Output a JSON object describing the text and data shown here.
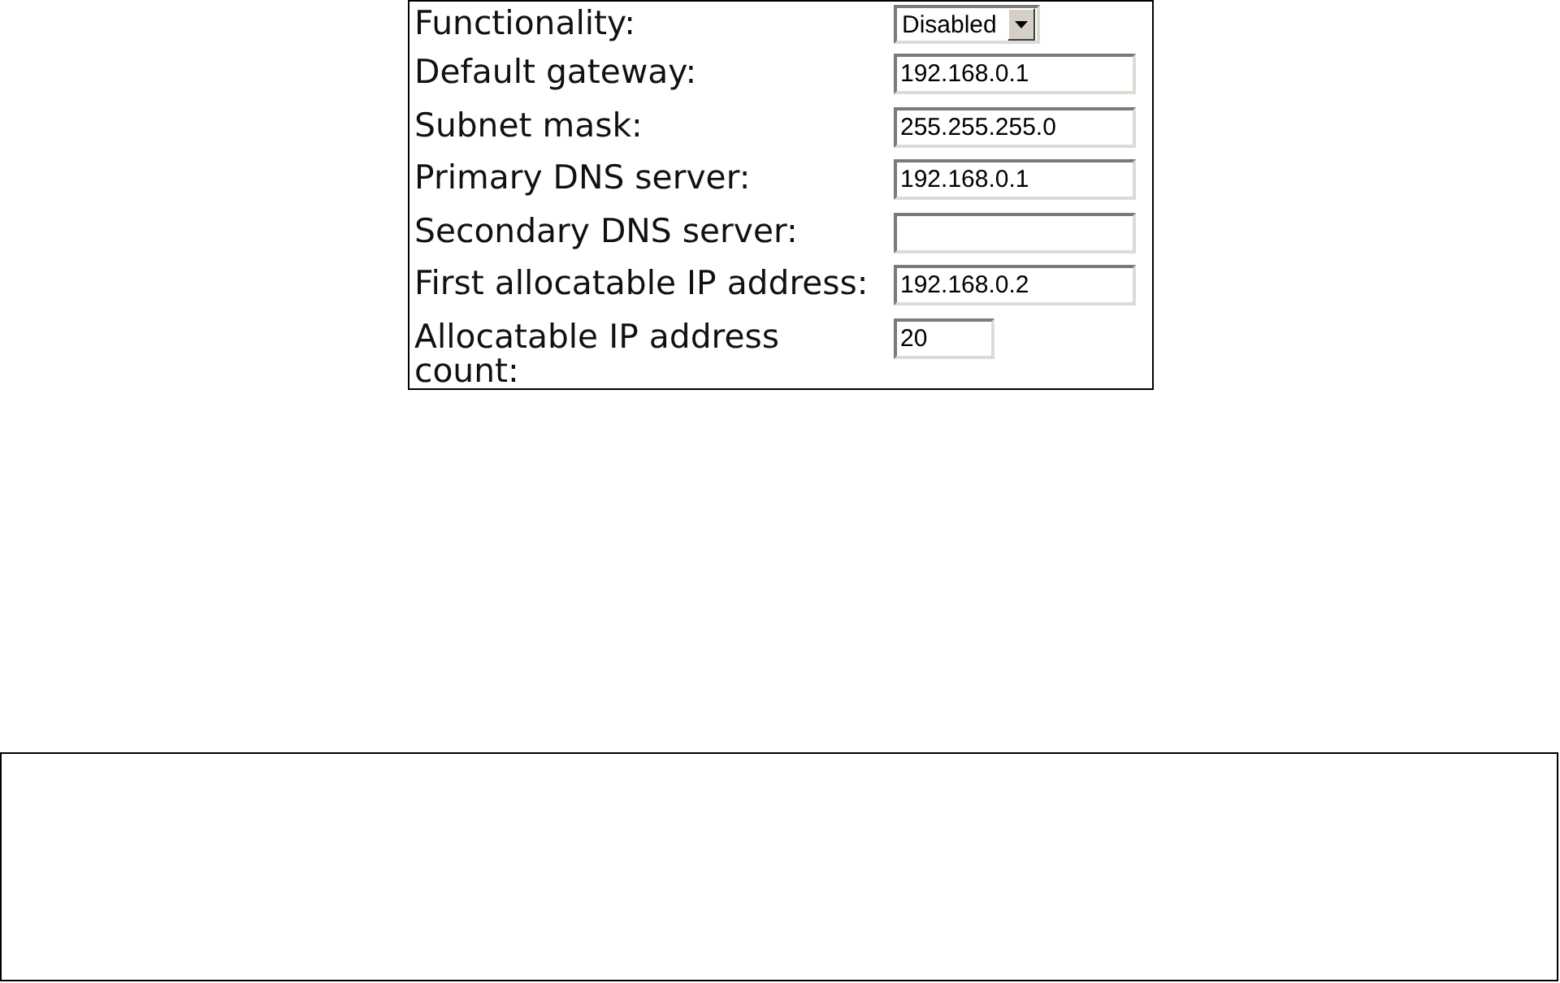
{
  "form": {
    "rows": [
      {
        "label": "Functionality:",
        "kind": "select",
        "value": "Disabled"
      },
      {
        "label": "Default gateway:",
        "kind": "text",
        "value": "192.168.0.1"
      },
      {
        "label": "Subnet mask:",
        "kind": "text",
        "value": "255.255.255.0"
      },
      {
        "label": "Primary DNS server:",
        "kind": "text",
        "value": "192.168.0.1"
      },
      {
        "label": "Secondary DNS server:",
        "kind": "text"
      },
      {
        "label": "First allocatable IP address:",
        "kind": "text",
        "value": "192.168.0.2"
      },
      {
        "label": "Allocatable IP address count:",
        "kind": "short",
        "value": "20"
      }
    ]
  }
}
